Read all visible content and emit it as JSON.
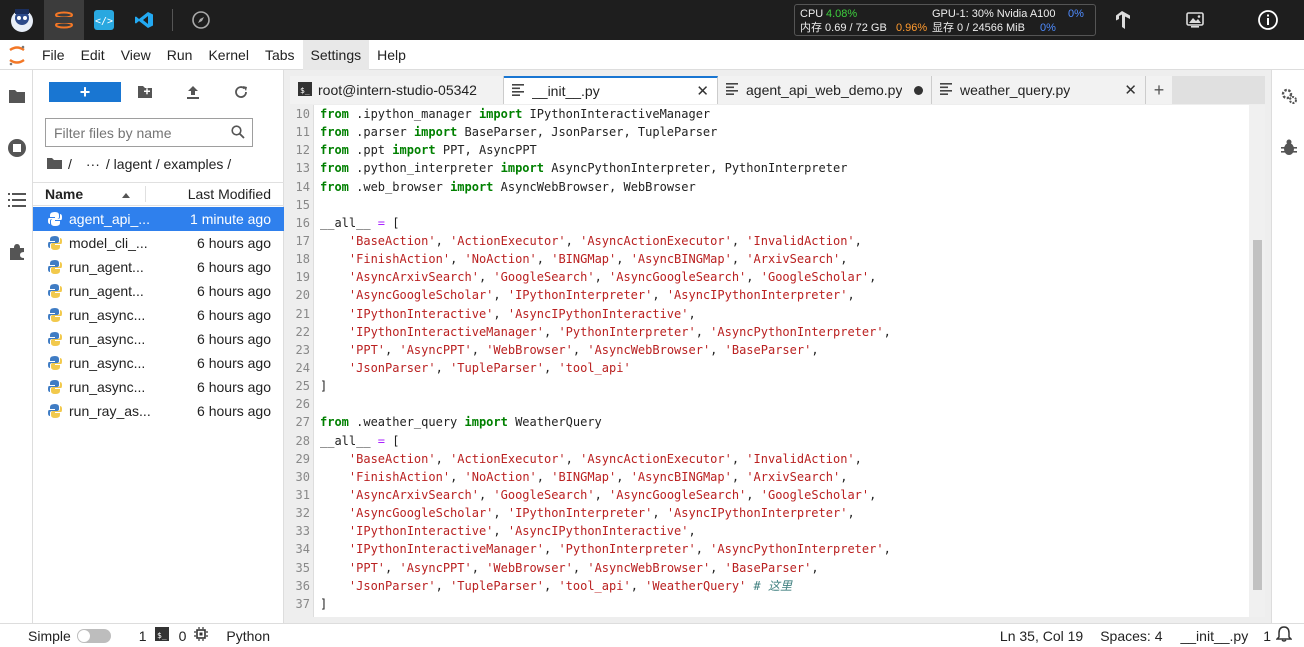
{
  "topbar": {
    "monitor": {
      "cpu_label": "CPU",
      "cpu_value": "4.08%",
      "mem_label": "内存 0.69 / 72 GB",
      "mem_value": "0.96%",
      "gpu_label": "GPU-1: 30% Nvidia A100",
      "gpu_value": "0%",
      "vram_label": "显存 0 / 24566 MiB",
      "vram_value": "0%"
    }
  },
  "menu": [
    "File",
    "Edit",
    "View",
    "Run",
    "Kernel",
    "Tabs",
    "Settings",
    "Help"
  ],
  "filebrowser": {
    "new_label": "+",
    "search_placeholder": "Filter files by name",
    "breadcrumb": [
      "/",
      "···",
      "/ lagent / examples /"
    ],
    "col_name": "Name",
    "col_modified": "Last Modified",
    "files": [
      {
        "name": "agent_api_...",
        "modified": "1 minute ago"
      },
      {
        "name": "model_cli_...",
        "modified": "6 hours ago"
      },
      {
        "name": "run_agent...",
        "modified": "6 hours ago"
      },
      {
        "name": "run_agent...",
        "modified": "6 hours ago"
      },
      {
        "name": "run_async...",
        "modified": "6 hours ago"
      },
      {
        "name": "run_async...",
        "modified": "6 hours ago"
      },
      {
        "name": "run_async...",
        "modified": "6 hours ago"
      },
      {
        "name": "run_async...",
        "modified": "6 hours ago"
      },
      {
        "name": "run_ray_as...",
        "modified": "6 hours ago"
      }
    ]
  },
  "tabs": [
    {
      "label": "root@intern-studio-05342"
    },
    {
      "label": "__init__.py"
    },
    {
      "label": "agent_api_web_demo.py"
    },
    {
      "label": "weather_query.py"
    }
  ],
  "tab_add": "+",
  "code": {
    "lines": [
      {
        "n": "10",
        "t": "from .ipython_manager import IPythonInteractiveManager"
      },
      {
        "n": "11",
        "t": "from .parser import BaseParser, JsonParser, TupleParser"
      },
      {
        "n": "12",
        "t": "from .ppt import PPT, AsyncPPT"
      },
      {
        "n": "13",
        "t": "from .python_interpreter import AsyncPythonInterpreter, PythonInterpreter"
      },
      {
        "n": "14",
        "t": "from .web_browser import AsyncWebBrowser, WebBrowser"
      },
      {
        "n": "15",
        "t": ""
      },
      {
        "n": "16",
        "t": "__all__ = ["
      },
      {
        "n": "17",
        "t": "    'BaseAction', 'ActionExecutor', 'AsyncActionExecutor', 'InvalidAction',"
      },
      {
        "n": "18",
        "t": "    'FinishAction', 'NoAction', 'BINGMap', 'AsyncBINGMap', 'ArxivSearch',"
      },
      {
        "n": "19",
        "t": "    'AsyncArxivSearch', 'GoogleSearch', 'AsyncGoogleSearch', 'GoogleScholar',"
      },
      {
        "n": "20",
        "t": "    'AsyncGoogleScholar', 'IPythonInterpreter', 'AsyncIPythonInterpreter',"
      },
      {
        "n": "21",
        "t": "    'IPythonInteractive', 'AsyncIPythonInteractive',"
      },
      {
        "n": "22",
        "t": "    'IPythonInteractiveManager', 'PythonInterpreter', 'AsyncPythonInterpreter',"
      },
      {
        "n": "23",
        "t": "    'PPT', 'AsyncPPT', 'WebBrowser', 'AsyncWebBrowser', 'BaseParser',"
      },
      {
        "n": "24",
        "t": "    'JsonParser', 'TupleParser', 'tool_api'"
      },
      {
        "n": "25",
        "t": "]"
      },
      {
        "n": "26",
        "t": ""
      },
      {
        "n": "27",
        "t": "from .weather_query import WeatherQuery"
      },
      {
        "n": "28",
        "t": "__all__ = ["
      },
      {
        "n": "29",
        "t": "    'BaseAction', 'ActionExecutor', 'AsyncActionExecutor', 'InvalidAction',"
      },
      {
        "n": "30",
        "t": "    'FinishAction', 'NoAction', 'BINGMap', 'AsyncBINGMap', 'ArxivSearch',"
      },
      {
        "n": "31",
        "t": "    'AsyncArxivSearch', 'GoogleSearch', 'AsyncGoogleSearch', 'GoogleScholar',"
      },
      {
        "n": "32",
        "t": "    'AsyncGoogleScholar', 'IPythonInterpreter', 'AsyncIPythonInterpreter',"
      },
      {
        "n": "33",
        "t": "    'IPythonInteractive', 'AsyncIPythonInteractive',"
      },
      {
        "n": "34",
        "t": "    'IPythonInteractiveManager', 'PythonInterpreter', 'AsyncPythonInterpreter',"
      },
      {
        "n": "35",
        "t": "    'PPT', 'AsyncPPT', 'WebBrowser', 'AsyncWebBrowser', 'BaseParser',"
      },
      {
        "n": "36",
        "t": "    'JsonParser', 'TupleParser', 'tool_api', 'WeatherQuery' # 这里"
      },
      {
        "n": "37",
        "t": "]"
      }
    ]
  },
  "status": {
    "mode": "Simple",
    "kernels": "1",
    "terminals": "0",
    "language": "Python",
    "position": "Ln 35, Col 19",
    "spaces": "Spaces: 4",
    "file": "__init__.py",
    "notifications": "1"
  },
  "colors": {
    "accent": "#1976d2",
    "selection": "#2f80ed"
  }
}
